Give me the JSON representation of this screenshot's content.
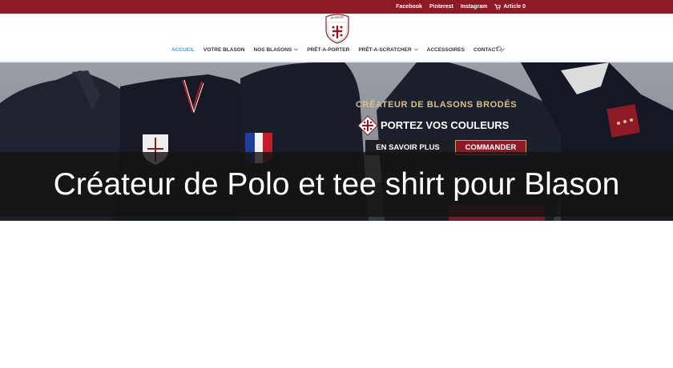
{
  "topbar": {
    "links": [
      "Facebook",
      "Pinterest",
      "Instagram"
    ],
    "cart_label": "Article 0",
    "cart_icon": "cart-icon",
    "background": "#8e1a25"
  },
  "header": {
    "logo_text": "amalsac",
    "nav": [
      {
        "label": "ACCUEIL",
        "active": true,
        "dropdown": false
      },
      {
        "label": "VOTRE BLASON",
        "active": false,
        "dropdown": false
      },
      {
        "label": "NOS BLASONS",
        "active": false,
        "dropdown": true
      },
      {
        "label": "PRÊT-A-PORTER",
        "active": false,
        "dropdown": false
      },
      {
        "label": "PRÊT-A-SCRATCHER",
        "active": false,
        "dropdown": true
      },
      {
        "label": "ACCESSOIRES",
        "active": false,
        "dropdown": false
      },
      {
        "label": "CONTACT",
        "active": false,
        "dropdown": true
      }
    ],
    "search_icon": "search-icon",
    "accent": "#2ea3f2"
  },
  "hero": {
    "title": "CRÉATEUR DE BLASONS BRODÉS",
    "subtitle": "PORTEZ VOS COULEURS",
    "more_button": "EN SAVOIR PLUS",
    "order_button": "COMMANDER",
    "gold": "#d9c08a"
  },
  "caption": {
    "text": "Créateur de Polo et tee shirt pour Blason"
  }
}
